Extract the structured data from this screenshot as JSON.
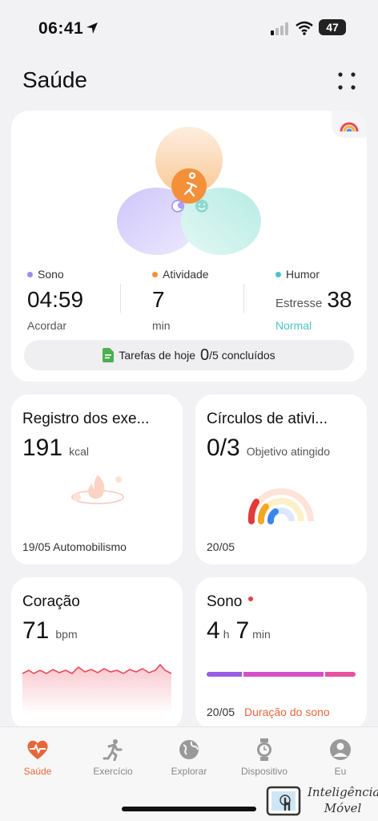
{
  "status_bar": {
    "time": "06:41",
    "battery": "47"
  },
  "header": {
    "title": "Saúde"
  },
  "summary": {
    "sleep": {
      "label": "Sono",
      "value": "04:59",
      "sub": "Acordar",
      "color": "#9b8cf0"
    },
    "activity": {
      "label": "Atividade",
      "value": "7",
      "sub": "min",
      "color": "#f5903a"
    },
    "mood": {
      "label": "Humor",
      "stress_label": "Estresse",
      "stress_value": "38",
      "sub": "Normal",
      "color": "#4cc3c3"
    },
    "tasks": {
      "label": "Tarefas de hoje",
      "done": "0",
      "total_text": "/5 concluídos"
    }
  },
  "cards": {
    "exercise": {
      "title": "Registro dos exe...",
      "value": "191",
      "unit": "kcal",
      "footer": "19/05 Automobilismo"
    },
    "activity_rings": {
      "title": "Círculos de ativi...",
      "value": "0/3",
      "unit": "Objetivo atingido",
      "footer": "20/05"
    },
    "heart": {
      "title": "Coração",
      "value": "71",
      "unit": "bpm"
    },
    "sleep": {
      "title": "Sono",
      "hours": "4",
      "h_unit": "h",
      "minutes": "7",
      "m_unit": "min",
      "date": "20/05",
      "warning": "Duração do sono"
    }
  },
  "tabbar": {
    "tabs": [
      {
        "label": "Saúde",
        "icon": "heart-pulse-icon",
        "active": true
      },
      {
        "label": "Exercício",
        "icon": "runner-icon",
        "active": false
      },
      {
        "label": "Explorar",
        "icon": "globe-icon",
        "active": false
      },
      {
        "label": "Dispositivo",
        "icon": "watch-icon",
        "active": false
      },
      {
        "label": "Eu",
        "icon": "profile-icon",
        "active": false
      }
    ]
  },
  "watermark": {
    "line1": "Inteligência",
    "line2": "Móvel"
  },
  "colors": {
    "accent": "#e8663a",
    "heart_line": "#e8485a"
  }
}
